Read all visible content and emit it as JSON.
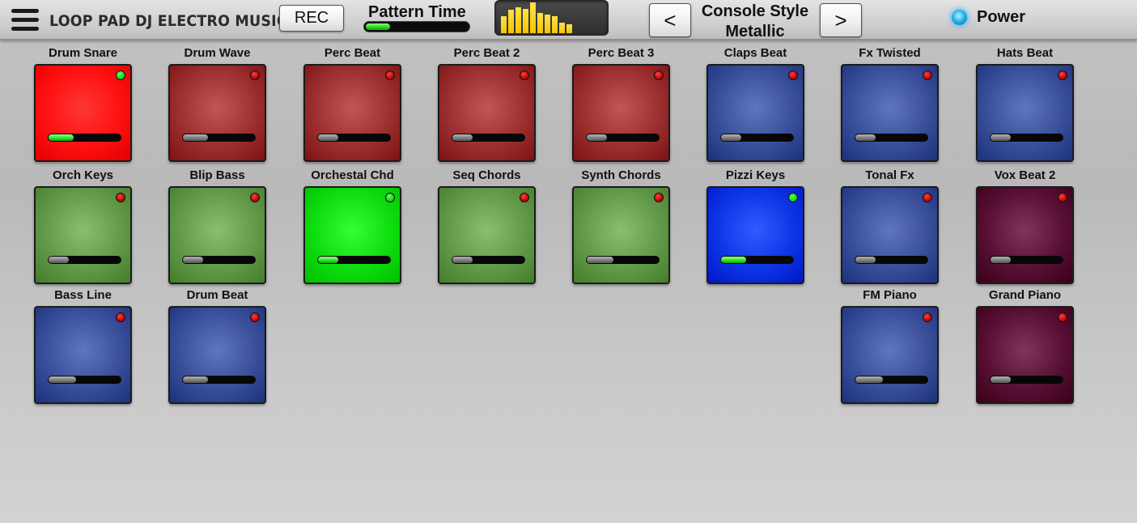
{
  "app": {
    "title": "LOOP PAD DJ ELECTRO MUSIC"
  },
  "toolbar": {
    "rec_label": "REC",
    "pattern_label": "Pattern Time",
    "pattern_progress": 0.24,
    "prev_label": "<",
    "next_label": ">",
    "style_line1": "Console Style",
    "style_line2": "Metallic",
    "power_label": "Power"
  },
  "equalizer": {
    "levels": [
      0.55,
      0.75,
      0.85,
      0.8,
      1.0,
      0.65,
      0.6,
      0.55,
      0.35,
      0.3
    ],
    "color": "#f5c400"
  },
  "colors": {
    "red": "#9c2f2f",
    "red_active": "#ff1010",
    "green": "#629a4a",
    "green_active": "#0edd0e",
    "blue": "#3a4f9a",
    "blue_active": "#0d35e6",
    "purple": "#581035",
    "led_on": "#1fd11f",
    "led_off": "#bf0606",
    "vol_on": "#2ee62a",
    "vol_off": "#7a7a7a"
  },
  "pads": [
    {
      "label": "Drum Snare",
      "color": "red",
      "active": true,
      "level": 0.35
    },
    {
      "label": "Drum Wave",
      "color": "red",
      "active": false,
      "level": 0.35
    },
    {
      "label": "Perc Beat",
      "color": "red",
      "active": false,
      "level": 0.28
    },
    {
      "label": "Perc Beat 2",
      "color": "red",
      "active": false,
      "level": 0.28
    },
    {
      "label": "Perc Beat 3",
      "color": "red",
      "active": false,
      "level": 0.28
    },
    {
      "label": "Claps Beat",
      "color": "blue",
      "active": false,
      "level": 0.28
    },
    {
      "label": "Fx Twisted",
      "color": "blue",
      "active": false,
      "level": 0.28
    },
    {
      "label": "Hats Beat",
      "color": "blue",
      "active": false,
      "level": 0.28
    },
    {
      "label": "Orch Keys",
      "color": "green",
      "active": false,
      "level": 0.28
    },
    {
      "label": "Blip Bass",
      "color": "green",
      "active": false,
      "level": 0.28
    },
    {
      "label": "Orchestal Chd",
      "color": "green",
      "active": true,
      "level": 0.28
    },
    {
      "label": "Seq Chords",
      "color": "green",
      "active": false,
      "level": 0.28
    },
    {
      "label": "Synth Chords",
      "color": "green",
      "active": false,
      "level": 0.37
    },
    {
      "label": "Pizzi Keys",
      "color": "blue",
      "active": true,
      "level": 0.35
    },
    {
      "label": "Tonal Fx",
      "color": "blue",
      "active": false,
      "level": 0.28
    },
    {
      "label": "Vox Beat 2",
      "color": "purple",
      "active": false,
      "level": 0.28
    },
    {
      "label": "Bass Line",
      "color": "blue",
      "active": false,
      "level": 0.38
    },
    {
      "label": "Drum Beat",
      "color": "blue",
      "active": false,
      "level": 0.35
    },
    {
      "label": "FM Piano",
      "color": "blue",
      "active": false,
      "level": 0.38
    },
    {
      "label": "Grand Piano",
      "color": "purple",
      "active": false,
      "level": 0.28
    }
  ]
}
